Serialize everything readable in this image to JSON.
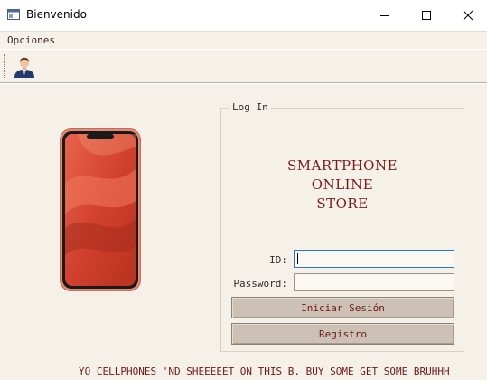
{
  "window": {
    "title": "Bienvenido"
  },
  "menu": {
    "opciones": "Opciones"
  },
  "login": {
    "group_title": "Log In",
    "store_lines": [
      "SMARTPHONE",
      "ONLINE",
      "STORE"
    ],
    "id_label": "ID:",
    "id_value": "",
    "password_label": "Password:",
    "password_value": "",
    "login_button": "Iniciar Sesión",
    "register_button": "Registro"
  },
  "footer": {
    "marquee": "YO CELLPHONES 'ND SHEEEEET ON THIS B. BUY SOME GET SOME BRUHHH"
  },
  "icons": [
    "app-icon",
    "minimize-icon",
    "maximize-icon",
    "close-icon",
    "user-avatar-icon"
  ],
  "colors": {
    "background": "#f5f0e8",
    "accent_text": "#7a1c1c",
    "button_bg": "#cdc0b4",
    "focus_border": "#2b78d0"
  }
}
